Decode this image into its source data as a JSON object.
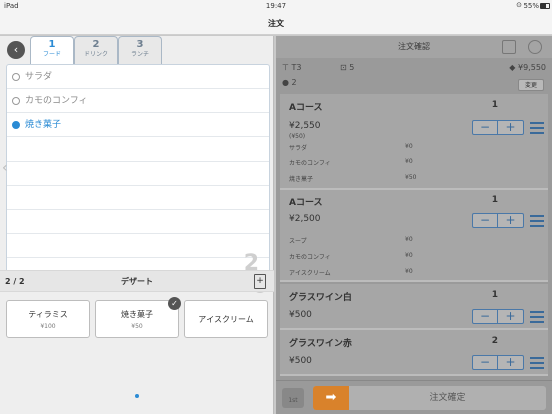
{
  "status": {
    "device": "iPad",
    "time": "19:47",
    "battery": "55%"
  },
  "nav": {
    "title": "注文"
  },
  "tabs": [
    {
      "num": "1",
      "label": "フード"
    },
    {
      "num": "2",
      "label": "ドリンク"
    },
    {
      "num": "3",
      "label": "ランチ"
    }
  ],
  "options": [
    "サラダ",
    "カモのコンフィ",
    "焼き菓子"
  ],
  "selected_option": "焼き菓子",
  "step_indicator": "2",
  "category": {
    "page": "2 / 2",
    "name": "デザート"
  },
  "items": [
    {
      "name": "ティラミス",
      "price": "¥100"
    },
    {
      "name": "焼き菓子",
      "price": "¥50"
    },
    {
      "name": "アイスクリーム",
      "price": ""
    }
  ],
  "right": {
    "header": "注文確認",
    "table": "T3",
    "cart_count": "5",
    "total": "¥9,550",
    "guests": "2",
    "change": "変更",
    "orders": [
      {
        "name": "Aコース",
        "qty": "1",
        "price": "¥2,550",
        "note": "(¥50)",
        "subs": [
          {
            "n": "サラダ",
            "p": "¥0"
          },
          {
            "n": "カモのコンフィ",
            "p": "¥0"
          },
          {
            "n": "焼き菓子",
            "p": "¥50"
          }
        ]
      },
      {
        "name": "Aコース",
        "qty": "1",
        "price": "¥2,500",
        "note": "",
        "subs": [
          {
            "n": "スープ",
            "p": "¥0"
          },
          {
            "n": "カモのコンフィ",
            "p": "¥0"
          },
          {
            "n": "アイスクリーム",
            "p": "¥0"
          }
        ]
      },
      {
        "name": "グラスワイン白",
        "qty": "1",
        "price": "¥500",
        "note": "",
        "subs": []
      },
      {
        "name": "グラスワイン赤",
        "qty": "2",
        "price": "¥500",
        "note": "",
        "subs": []
      }
    ],
    "confirm": "注文確定",
    "seat_label": "1st"
  },
  "colors": {
    "accent": "#2b8bd4",
    "confirm_orange": "#d9822b"
  }
}
